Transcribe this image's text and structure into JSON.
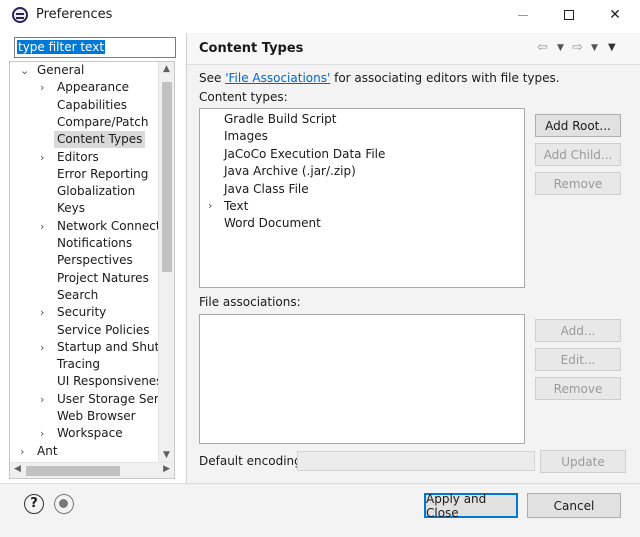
{
  "window": {
    "title": "Preferences"
  },
  "filter": {
    "value": "type filter text"
  },
  "tree": {
    "items": [
      {
        "label": "General",
        "arrow": "⌄",
        "indent": 0,
        "expanded": true
      },
      {
        "label": "Appearance",
        "arrow": "›",
        "indent": 1
      },
      {
        "label": "Capabilities",
        "arrow": "",
        "indent": 1
      },
      {
        "label": "Compare/Patch",
        "arrow": "",
        "indent": 1
      },
      {
        "label": "Content Types",
        "arrow": "",
        "indent": 1,
        "selected": true
      },
      {
        "label": "Editors",
        "arrow": "›",
        "indent": 1
      },
      {
        "label": "Error Reporting",
        "arrow": "",
        "indent": 1
      },
      {
        "label": "Globalization",
        "arrow": "",
        "indent": 1
      },
      {
        "label": "Keys",
        "arrow": "",
        "indent": 1
      },
      {
        "label": "Network Connection",
        "arrow": "›",
        "indent": 1
      },
      {
        "label": "Notifications",
        "arrow": "",
        "indent": 1
      },
      {
        "label": "Perspectives",
        "arrow": "",
        "indent": 1
      },
      {
        "label": "Project Natures",
        "arrow": "",
        "indent": 1
      },
      {
        "label": "Search",
        "arrow": "",
        "indent": 1
      },
      {
        "label": "Security",
        "arrow": "›",
        "indent": 1
      },
      {
        "label": "Service Policies",
        "arrow": "",
        "indent": 1
      },
      {
        "label": "Startup and Shutdown",
        "arrow": "›",
        "indent": 1
      },
      {
        "label": "Tracing",
        "arrow": "",
        "indent": 1
      },
      {
        "label": "UI Responsiveness Monitoring",
        "arrow": "",
        "indent": 1
      },
      {
        "label": "User Storage Service",
        "arrow": "›",
        "indent": 1
      },
      {
        "label": "Web Browser",
        "arrow": "",
        "indent": 1
      },
      {
        "label": "Workspace",
        "arrow": "›",
        "indent": 1
      },
      {
        "label": "Ant",
        "arrow": "›",
        "indent": 0
      }
    ]
  },
  "page": {
    "title": "Content Types",
    "see_prefix": "See ",
    "see_link": "'File Associations'",
    "see_suffix": " for associating editors with file types.",
    "content_types_label": "Content types:",
    "content_types": [
      {
        "label": "Gradle Build Script",
        "arrow": ""
      },
      {
        "label": "Images",
        "arrow": ""
      },
      {
        "label": "JaCoCo Execution Data File",
        "arrow": ""
      },
      {
        "label": "Java Archive (.jar/.zip)",
        "arrow": ""
      },
      {
        "label": "Java Class File",
        "arrow": ""
      },
      {
        "label": "Text",
        "arrow": "›"
      },
      {
        "label": "Word Document",
        "arrow": ""
      }
    ],
    "file_assoc_label": "File associations:",
    "default_encoding_label": "Default encoding:",
    "buttons": {
      "add_root": "Add Root...",
      "add_child": "Add Child...",
      "remove1": "Remove",
      "add": "Add...",
      "edit": "Edit...",
      "remove2": "Remove",
      "update": "Update"
    }
  },
  "footer": {
    "apply_close": "Apply and Close",
    "cancel": "Cancel"
  }
}
